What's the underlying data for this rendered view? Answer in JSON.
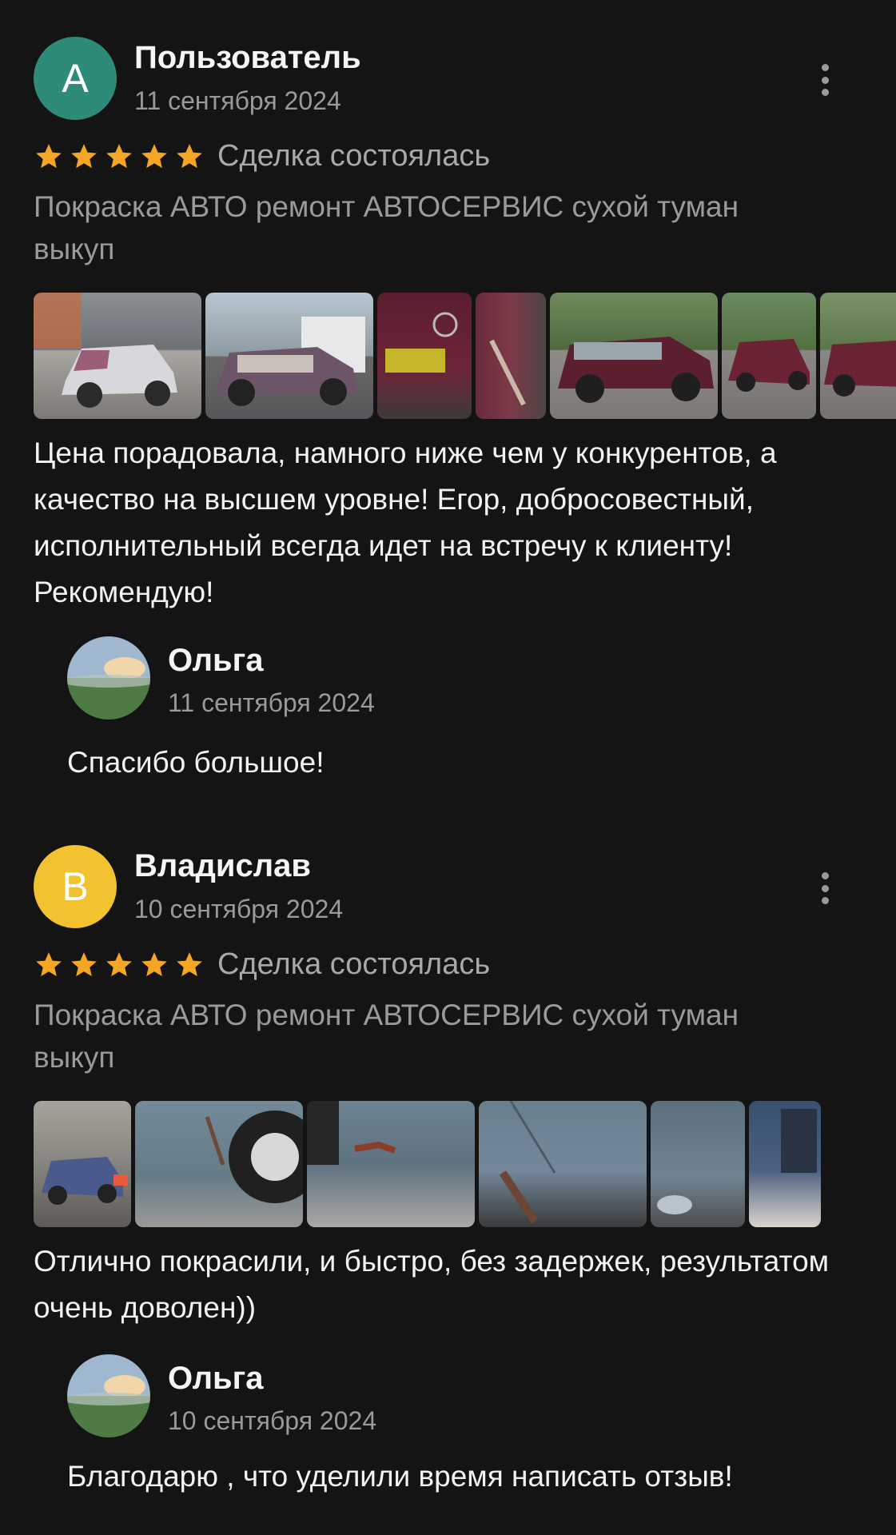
{
  "colors": {
    "background": "#141414",
    "star": "#f5a623",
    "avatar_a": "#2e8b7a",
    "avatar_b": "#f2c230",
    "muted_text": "#9a9a9a"
  },
  "reviews": [
    {
      "avatar_letter": "А",
      "author": "Пользователь",
      "date": "11 сентября 2024",
      "rating": 5,
      "deal_status": "Сделка состоялась",
      "service_title": "Покраска АВТО ремонт АВТОСЕРВИС сухой туман выкуп",
      "photos_icon": "car-photo",
      "text": "Цена порадовала, намного ниже чем у конкурентов, а качество на высшем уровне! Егор, добросовестный, исполнительный всегда идет на встречу к клиенту! Рекомендую!",
      "reply": {
        "author": "Ольга",
        "date": "11 сентября 2024",
        "text": "Спасибо большое!"
      }
    },
    {
      "avatar_letter": "В",
      "author": "Владислав",
      "date": "10 сентября 2024",
      "rating": 5,
      "deal_status": "Сделка состоялась",
      "service_title": "Покраска АВТО ремонт АВТОСЕРВИС сухой туман выкуп",
      "photos_icon": "car-photo",
      "text": "Отлично покрасили, и быстро, без задержек, результатом очень доволен))",
      "reply": {
        "author": "Ольга",
        "date": "10 сентября 2024",
        "text": "Благодарю , что уделили время написать отзыв!"
      }
    }
  ]
}
